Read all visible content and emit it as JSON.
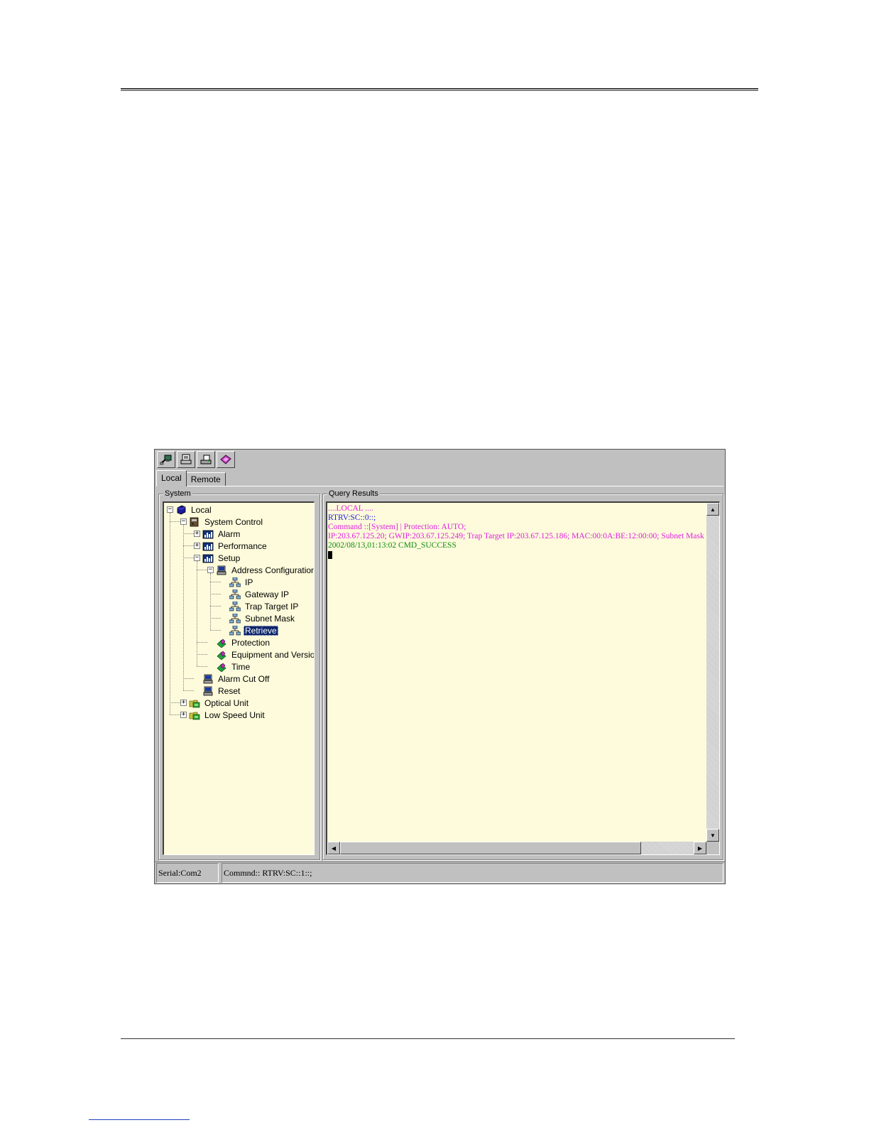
{
  "toolbar": {
    "buttons": [
      {
        "icon": "connect-icon"
      },
      {
        "icon": "print-preview-icon"
      },
      {
        "icon": "print-icon"
      },
      {
        "icon": "help-book-icon"
      }
    ]
  },
  "tabs": [
    {
      "label": "Local",
      "active": true
    },
    {
      "label": "Remote",
      "active": false
    }
  ],
  "system_panel": {
    "title": "System",
    "tree": [
      {
        "label": "Local",
        "state": "expanded",
        "icon": "local-cube-icon"
      },
      {
        "label": "System Control",
        "state": "expanded",
        "icon": "system-control-icon"
      },
      {
        "label": "Alarm",
        "state": "collapsed",
        "icon": "chart-folder-icon"
      },
      {
        "label": "Performance",
        "state": "collapsed",
        "icon": "chart-folder-icon"
      },
      {
        "label": "Setup",
        "state": "expanded",
        "icon": "chart-folder-icon"
      },
      {
        "label": "Address Configuration",
        "state": "expanded",
        "icon": "computer-icon"
      },
      {
        "label": "IP",
        "state": "leaf",
        "icon": "network-icon"
      },
      {
        "label": "Gateway IP",
        "state": "leaf",
        "icon": "network-icon"
      },
      {
        "label": "Trap Target IP",
        "state": "leaf",
        "icon": "network-icon"
      },
      {
        "label": "Subnet Mask",
        "state": "leaf",
        "icon": "network-icon"
      },
      {
        "label": "Retrieve",
        "state": "leaf",
        "icon": "network-icon",
        "selected": true
      },
      {
        "label": "Protection",
        "state": "leaf",
        "icon": "check-diamond-icon"
      },
      {
        "label": "Equipment and Version",
        "state": "leaf",
        "icon": "check-diamond-icon"
      },
      {
        "label": "Time",
        "state": "leaf",
        "icon": "check-diamond-icon"
      },
      {
        "label": "Alarm Cut Off",
        "state": "leaf",
        "icon": "computer-icon"
      },
      {
        "label": "Reset",
        "state": "leaf",
        "icon": "computer-icon"
      },
      {
        "label": "Optical Unit",
        "state": "collapsed",
        "icon": "unit-folder-icon"
      },
      {
        "label": "Low Speed Unit",
        "state": "collapsed",
        "icon": "unit-folder-icon"
      }
    ]
  },
  "query_panel": {
    "title": "Query Results",
    "lines": [
      {
        "text": "....LOCAL ....",
        "color": "#e020e0"
      },
      {
        "text": "RTRV:SC::0::;",
        "color": "#2020e0"
      },
      {
        "text": "Command ::[System] | Protection: AUTO;",
        "color": "#e020e0"
      },
      {
        "text": "  IP:203.67.125.20;  GWIP:203.67.125.249;  Trap Target IP:203.67.125.186;  MAC:00:0A:BE:12:00:00;  Subnet Mask",
        "color": "#e020e0"
      },
      {
        "text": "2002/08/13,01:13:02 CMD_SUCCESS",
        "color": "#108a10"
      }
    ]
  },
  "status_bar": {
    "port": "Serial:Com2",
    "command": "Commnd:: RTRV:SC::1::;"
  }
}
